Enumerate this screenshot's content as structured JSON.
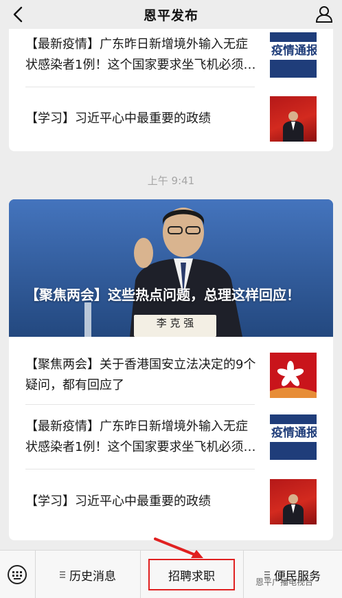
{
  "navbar": {
    "title": "恩平发布",
    "back_icon": "chevron-left-icon",
    "profile_icon": "user-icon"
  },
  "top_card": {
    "items": [
      {
        "title": "【最新疫情】广东昨日新增境外输入无症状感染者1例！这个国家要求坐飞机必须戴口罩",
        "thumb_text": "疫情通报"
      },
      {
        "title": "【学习】习近平心中最重要的政绩"
      }
    ]
  },
  "timestamp": "上午 9:41",
  "main_card": {
    "hero": {
      "title": "【聚焦两会】这些热点问题，总理这样回应！",
      "nameplate": "李 克 强"
    },
    "items": [
      {
        "title": "【聚焦两会】关于香港国安立法决定的9个疑问，都有回应了"
      },
      {
        "title": "【最新疫情】广东昨日新增境外输入无症状感染者1例！这个国家要求坐飞机必须戴口罩",
        "thumb_text": "疫情通报"
      },
      {
        "title": "【学习】习近平心中最重要的政绩"
      }
    ]
  },
  "tabbar": {
    "keyboard_icon": "keyboard-icon",
    "tabs": [
      {
        "label": "历史消息"
      },
      {
        "label": "招聘求职"
      },
      {
        "label": "便民服务"
      }
    ]
  },
  "watermark": "恩平广播电视台",
  "colors": {
    "highlight": "#e02020",
    "background": "#ededed",
    "thumb_blue": "#1f3d7a",
    "thumb_red": "#c9141b"
  }
}
